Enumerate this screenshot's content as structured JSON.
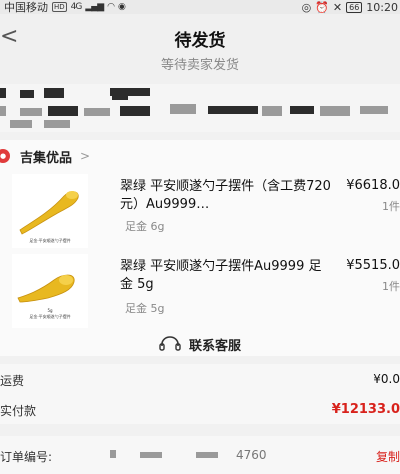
{
  "status_bar": {
    "carrier": "中国移动",
    "network_badge": "HD",
    "signal": "4G",
    "battery": "66",
    "time": "10:20"
  },
  "header": {
    "title": "待发货",
    "subtitle": "等待卖家发货"
  },
  "shop": {
    "name": "吉集优品",
    "arrow": ">"
  },
  "items": [
    {
      "title": "翠绿 平安顺遂勺子摆件（含工费720元）Au9999…",
      "spec": "足金 6g",
      "price": "¥6618.0",
      "qty": "1件"
    },
    {
      "title": "翠绿 平安顺遂勺子摆件Au9999 足金 5g",
      "spec": "足金 5g",
      "price": "¥5515.0",
      "qty": "1件"
    }
  ],
  "thumb_captions": [
    "足金·平安顺遂勺子摆件",
    "5g",
    "足金·平安顺遂勺子摆件"
  ],
  "service": {
    "label": "联系客服"
  },
  "summary": {
    "shipping_label": "运费",
    "shipping_value": "¥0.0",
    "paid_label": "实付款",
    "paid_value": "¥12133.0"
  },
  "order": {
    "number_label": "订单编号:",
    "number_tail": "4760",
    "copy_label": "复制"
  },
  "colors": {
    "accent_red": "#d8221c",
    "gold": "#e8b820",
    "background": "#f1f1f1"
  }
}
